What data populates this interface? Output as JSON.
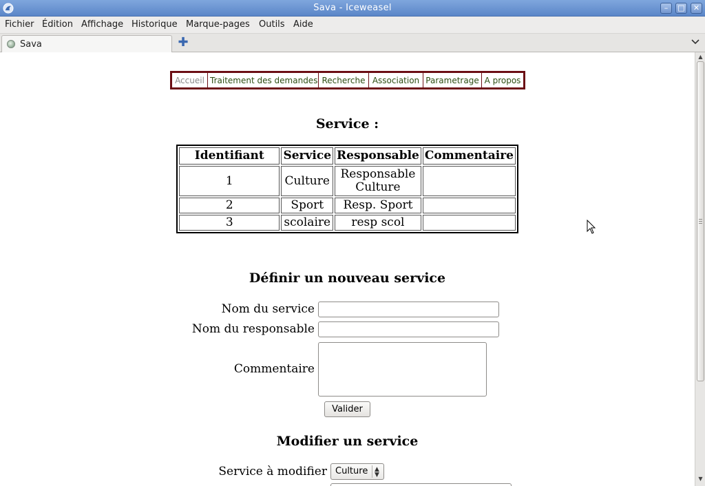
{
  "window": {
    "title": "Sava - Iceweasel",
    "icon": "iceweasel-app-icon",
    "controls": {
      "minimize": "–",
      "maximize": "□",
      "close": "✕"
    }
  },
  "menu": {
    "items": [
      {
        "label": "Fichier"
      },
      {
        "label": "Édition"
      },
      {
        "label": "Affichage"
      },
      {
        "label": "Historique"
      },
      {
        "label": "Marque-pages"
      },
      {
        "label": "Outils"
      },
      {
        "label": "Aide"
      }
    ]
  },
  "tabs": {
    "items": [
      {
        "label": "Sava",
        "icon": "globe-icon"
      }
    ],
    "new_tab_symbol": "✚",
    "list_symbol": "⌄"
  },
  "page": {
    "nav": {
      "items": [
        {
          "label": "Accueil",
          "active": true
        },
        {
          "label": "Traitement des demandes"
        },
        {
          "label": "Recherche"
        },
        {
          "label": "Association"
        },
        {
          "label": "Parametrage"
        },
        {
          "label": "A propos"
        }
      ]
    },
    "service_heading": "Service :",
    "table": {
      "headers": [
        "Identifiant",
        "Service",
        "Responsable",
        "Commentaire"
      ],
      "rows": [
        [
          "1",
          "Culture",
          "Responsable Culture",
          ""
        ],
        [
          "2",
          "Sport",
          "Resp. Sport",
          ""
        ],
        [
          "3",
          "scolaire",
          "resp scol",
          ""
        ]
      ]
    },
    "new_heading": "Définir un nouveau service",
    "form": {
      "service_name_label": "Nom du service",
      "service_name_value": "",
      "manager_label": "Nom du responsable",
      "manager_value": "",
      "comment_label": "Commentaire",
      "comment_value": "",
      "submit_label": "Valider"
    },
    "modify_heading": "Modifier un service",
    "modify": {
      "select_label": "Service à modifier",
      "selected_value": "Culture"
    }
  },
  "colors": {
    "nav_border": "#6b0e14",
    "nav_link": "#2c4d12",
    "nav_active": "#8a8a8a",
    "titlebar": "#5b86c8"
  }
}
